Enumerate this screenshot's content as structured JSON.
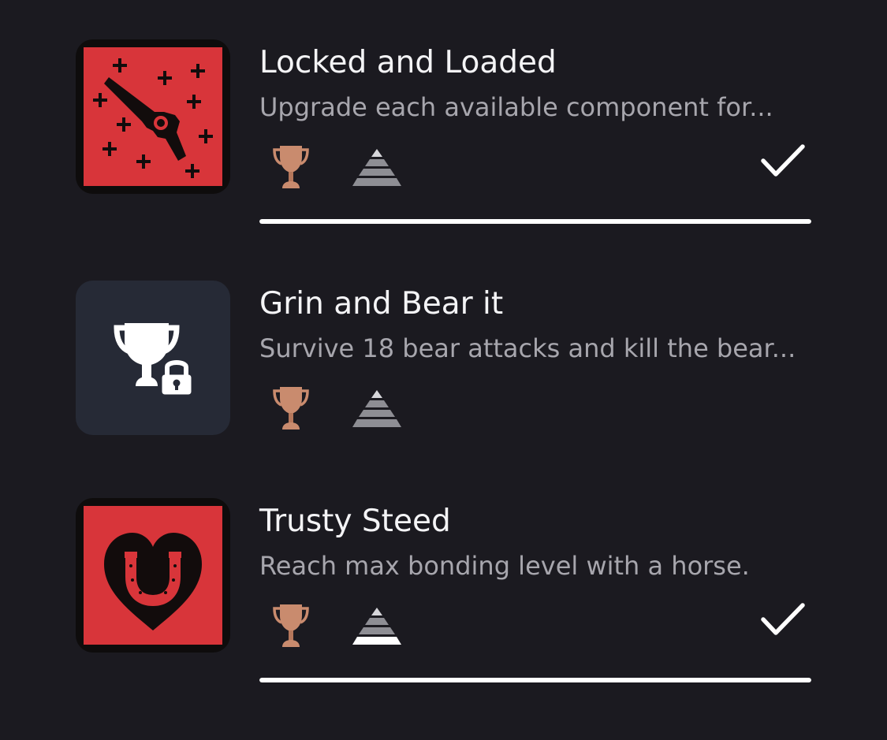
{
  "trophies": [
    {
      "title": "Locked and Loaded",
      "description": "Upgrade each available component for...",
      "grade": "bronze",
      "icon": "revolver-icon",
      "earned": true,
      "progress": 1.0
    },
    {
      "title": "Grin and Bear it",
      "description": "Survive 18 bear attacks and kill the bear...",
      "grade": "bronze",
      "icon": "locked-trophy-icon",
      "earned": false,
      "progress": null
    },
    {
      "title": "Trusty Steed",
      "description": "Reach max bonding level with a horse.",
      "grade": "bronze",
      "icon": "horseshoe-heart-icon",
      "earned": true,
      "progress": 1.0
    }
  ],
  "colors": {
    "background": "#1b1a20",
    "art_red": "#d8353a",
    "locked_tile": "#262a36",
    "bronze": "#c98b6e",
    "text_primary": "#f4f4f6",
    "text_secondary": "#a7a6ad"
  }
}
